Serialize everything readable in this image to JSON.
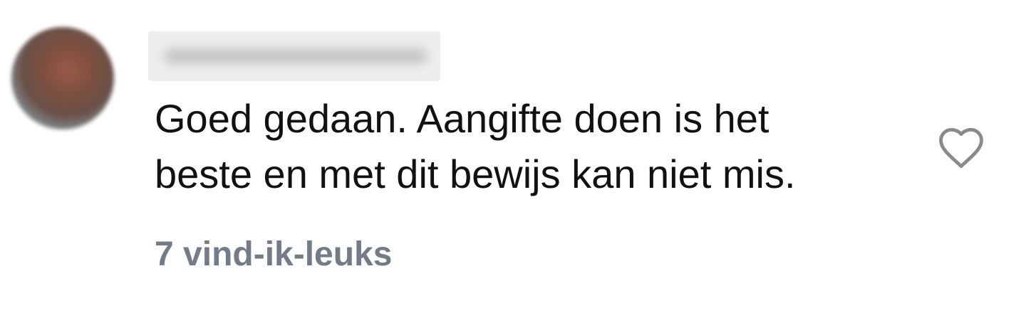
{
  "comment": {
    "avatar_icon": "user-avatar-blurred",
    "username": "",
    "text_lines": [
      "Goed gedaan. Aangifte doen is het",
      "beste en met dit bewijs kan niet mis."
    ],
    "like_icon": "heart-outline-icon",
    "likes_label": "7 vind-ik-leuks"
  },
  "colors": {
    "text": "#111111",
    "secondary": "#737b86",
    "icon": "#8a8a8a"
  }
}
